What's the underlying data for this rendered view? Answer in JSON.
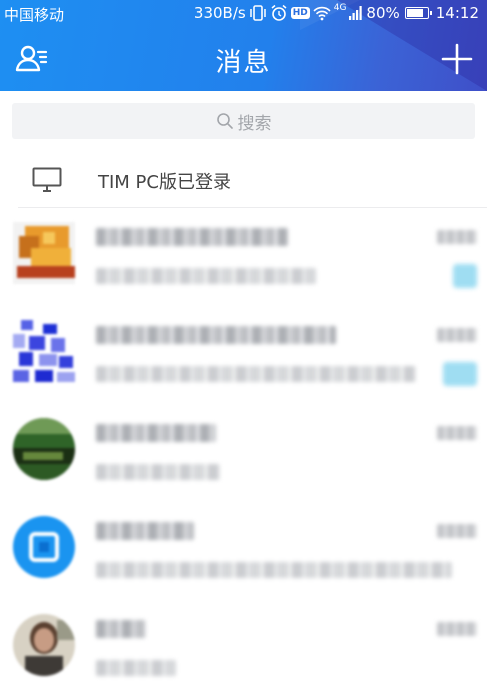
{
  "status_bar": {
    "carrier": "中国移动",
    "network_speed": "330B/s",
    "hd_badge": "HD",
    "network_type": "4G",
    "battery": "80%",
    "time": "14:12"
  },
  "title_bar": {
    "title": "消息"
  },
  "search": {
    "placeholder": "搜索"
  },
  "pc_login": {
    "label": "TIM PC版已登录"
  },
  "colors": {
    "header_blue": "#1e8ff2",
    "header_indigo": "#3f4fc8",
    "unread_badge": "#7fd2ee"
  },
  "chats": [
    {
      "avatar_style": "orange-square",
      "name": "",
      "preview": "",
      "time": "",
      "has_unread": true
    },
    {
      "avatar_style": "blue-pixel-square",
      "name": "",
      "preview": "",
      "time": "",
      "has_unread": true
    },
    {
      "avatar_style": "green-landscape-circle",
      "name": "",
      "preview": "",
      "time": "",
      "has_unread": false
    },
    {
      "avatar_style": "blue-circle",
      "name": "",
      "preview": "",
      "time": "",
      "has_unread": false
    },
    {
      "avatar_style": "person-photo-circle",
      "name": "",
      "preview": "",
      "time": "",
      "has_unread": false
    }
  ]
}
